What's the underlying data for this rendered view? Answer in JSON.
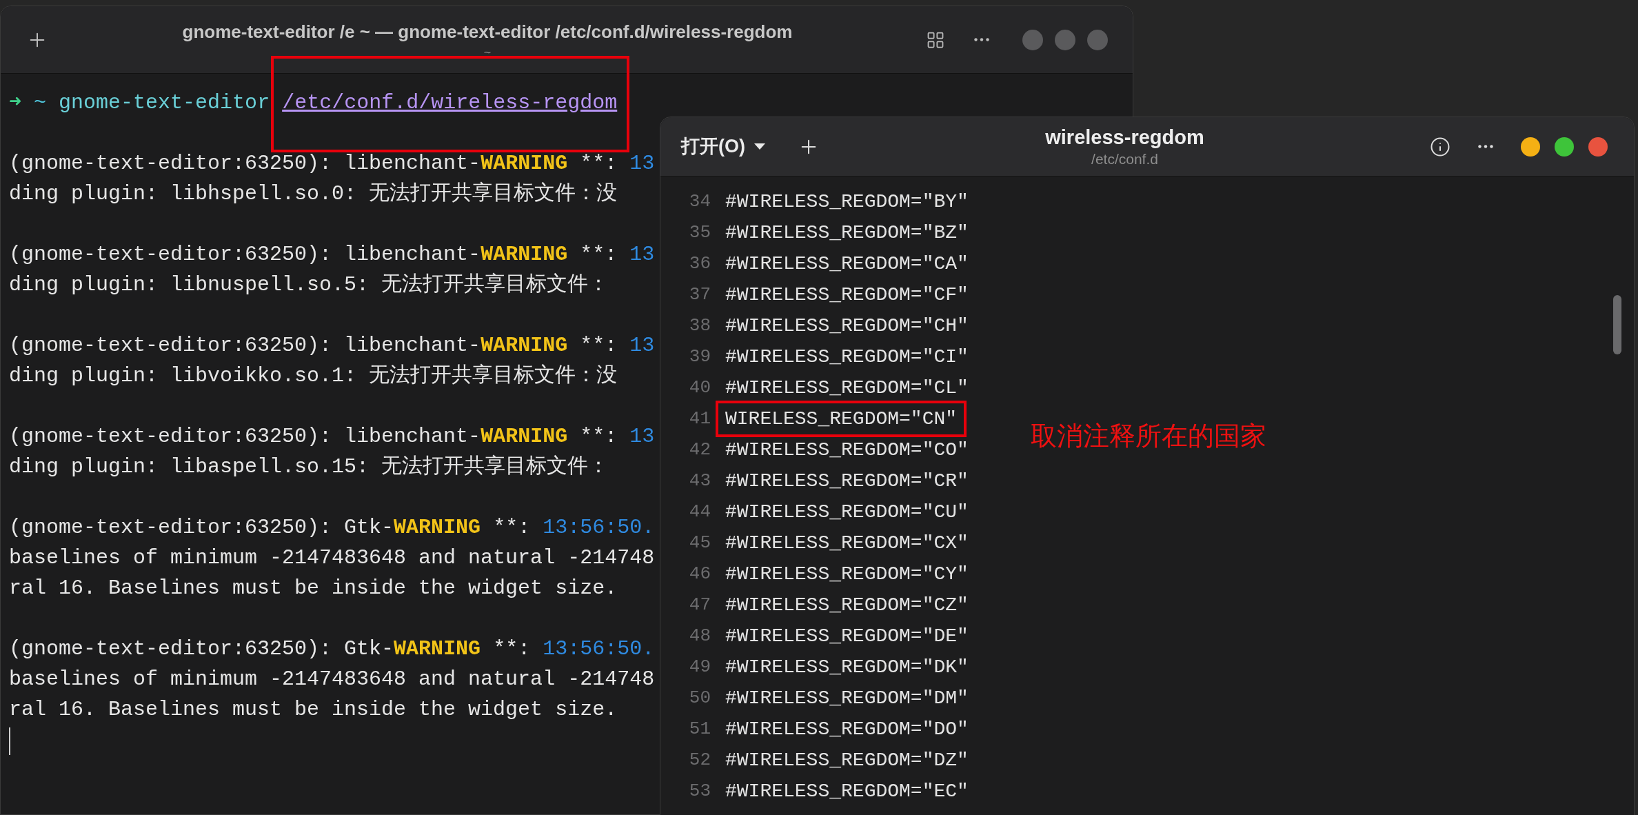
{
  "terminal": {
    "title": "gnome-text-editor /e ~ — gnome-text-editor /etc/conf.d/wireless-regdom",
    "subtitle": "~",
    "prompt": {
      "arrow": "➜",
      "dir": "~",
      "command": "gnome-text-editor",
      "argument": "/etc/conf.d/wireless-regdom",
      "highlighted": true
    },
    "messages": [
      {
        "source": "(gnome-text-editor:63250): libenchant-",
        "level": "WARNING",
        "marker": "**:",
        "time": "13",
        "lines": [
          "ding plugin: libhspell.so.0: 无法打开共享目标文件：没"
        ]
      },
      {
        "source": "(gnome-text-editor:63250): libenchant-",
        "level": "WARNING",
        "marker": "**:",
        "time": "13",
        "lines": [
          "ding plugin: libnuspell.so.5: 无法打开共享目标文件："
        ]
      },
      {
        "source": "(gnome-text-editor:63250): libenchant-",
        "level": "WARNING",
        "marker": "**:",
        "time": "13",
        "lines": [
          "ding plugin: libvoikko.so.1: 无法打开共享目标文件：没"
        ]
      },
      {
        "source": "(gnome-text-editor:63250): libenchant-",
        "level": "WARNING",
        "marker": "**:",
        "time": "13",
        "lines": [
          "ding plugin: libaspell.so.15: 无法打开共享目标文件："
        ]
      },
      {
        "source": "(gnome-text-editor:63250): Gtk-",
        "level": "WARNING",
        "marker": "**:",
        "time": "13:56:50.",
        "lines": [
          "baselines of minimum -2147483648 and natural -214748",
          "ral 16. Baselines must be inside the widget size."
        ]
      },
      {
        "source": "(gnome-text-editor:63250): Gtk-",
        "level": "WARNING",
        "marker": "**:",
        "time": "13:56:50.",
        "lines": [
          "baselines of minimum -2147483648 and natural -214748",
          "ral 16. Baselines must be inside the widget size."
        ]
      }
    ]
  },
  "editor": {
    "open_button": "打开(O)",
    "title": "wireless-regdom",
    "subtitle": "/etc/conf.d",
    "lines": [
      {
        "number": "34",
        "text": "#WIRELESS_REGDOM=\"BY\"",
        "highlighted": false
      },
      {
        "number": "35",
        "text": "#WIRELESS_REGDOM=\"BZ\"",
        "highlighted": false
      },
      {
        "number": "36",
        "text": "#WIRELESS_REGDOM=\"CA\"",
        "highlighted": false
      },
      {
        "number": "37",
        "text": "#WIRELESS_REGDOM=\"CF\"",
        "highlighted": false
      },
      {
        "number": "38",
        "text": "#WIRELESS_REGDOM=\"CH\"",
        "highlighted": false
      },
      {
        "number": "39",
        "text": "#WIRELESS_REGDOM=\"CI\"",
        "highlighted": false
      },
      {
        "number": "40",
        "text": "#WIRELESS_REGDOM=\"CL\"",
        "highlighted": false
      },
      {
        "number": "41",
        "text": "WIRELESS_REGDOM=\"CN\"",
        "highlighted": true
      },
      {
        "number": "42",
        "text": "#WIRELESS_REGDOM=\"CO\"",
        "highlighted": false
      },
      {
        "number": "43",
        "text": "#WIRELESS_REGDOM=\"CR\"",
        "highlighted": false
      },
      {
        "number": "44",
        "text": "#WIRELESS_REGDOM=\"CU\"",
        "highlighted": false
      },
      {
        "number": "45",
        "text": "#WIRELESS_REGDOM=\"CX\"",
        "highlighted": false
      },
      {
        "number": "46",
        "text": "#WIRELESS_REGDOM=\"CY\"",
        "highlighted": false
      },
      {
        "number": "47",
        "text": "#WIRELESS_REGDOM=\"CZ\"",
        "highlighted": false
      },
      {
        "number": "48",
        "text": "#WIRELESS_REGDOM=\"DE\"",
        "highlighted": false
      },
      {
        "number": "49",
        "text": "#WIRELESS_REGDOM=\"DK\"",
        "highlighted": false
      },
      {
        "number": "50",
        "text": "#WIRELESS_REGDOM=\"DM\"",
        "highlighted": false
      },
      {
        "number": "51",
        "text": "#WIRELESS_REGDOM=\"DO\"",
        "highlighted": false
      },
      {
        "number": "52",
        "text": "#WIRELESS_REGDOM=\"DZ\"",
        "highlighted": false
      },
      {
        "number": "53",
        "text": "#WIRELESS_REGDOM=\"EC\"",
        "highlighted": false
      }
    ]
  },
  "annotation": {
    "note": "取消注释所在的国家"
  }
}
